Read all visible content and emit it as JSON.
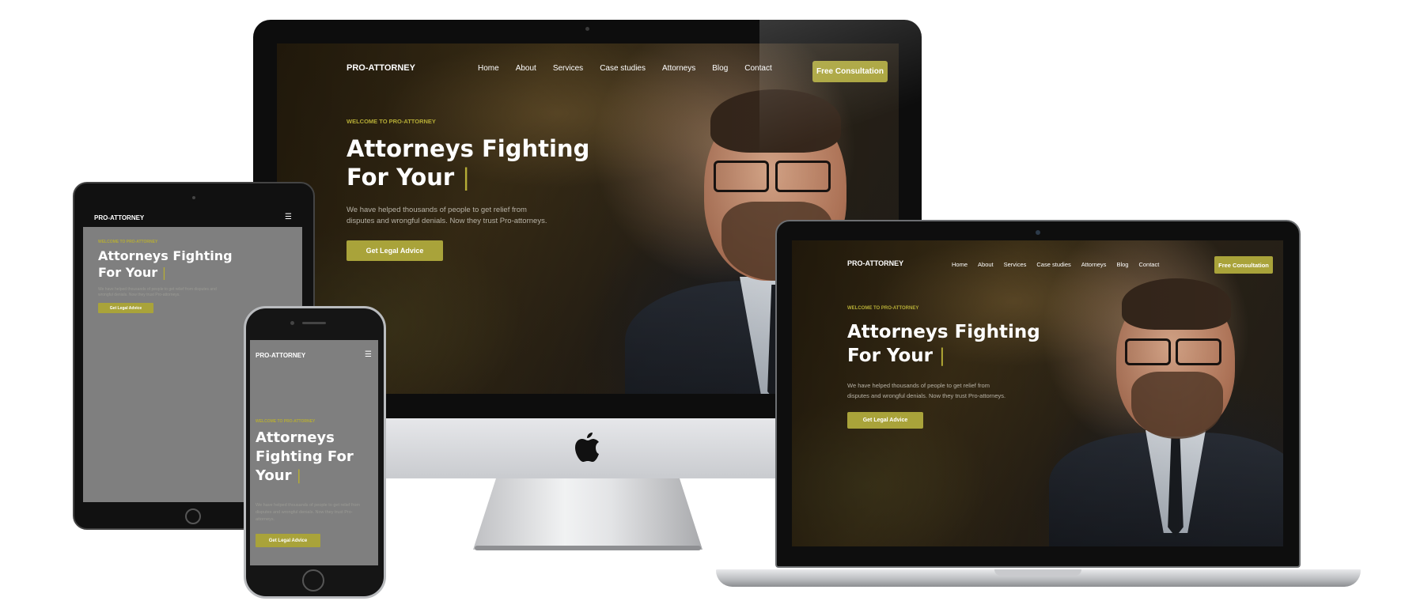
{
  "site": {
    "brand": "PRO-ATTORNEY",
    "nav": [
      "Home",
      "About",
      "Services",
      "Case studies",
      "Attorneys",
      "Blog",
      "Contact"
    ],
    "cta_label": "Free Consultation",
    "kicker": "WELCOME TO PRO-ATTORNEY",
    "headline_line1": "Attorneys Fighting",
    "headline_line2": "For Your",
    "headline_phone_1": "Attorneys",
    "headline_phone_2": "Fighting For",
    "headline_phone_3": "Your",
    "caret": "|",
    "paragraph_line1": "We have helped thousands of people to get relief from",
    "paragraph_line2": "disputes and wrongful denials. Now they trust Pro-attorneys.",
    "paragraph_full": "We have helped thousands of people to get relief from disputes and wrongful denials. Now they trust Pro-attorneys.",
    "button_label": "Get Legal Advice"
  },
  "colors": {
    "accent": "#a9a33a",
    "kicker": "#b5ac36",
    "mobile_bg": "#7f7f7f"
  },
  "icons": {
    "menu": "☰"
  }
}
